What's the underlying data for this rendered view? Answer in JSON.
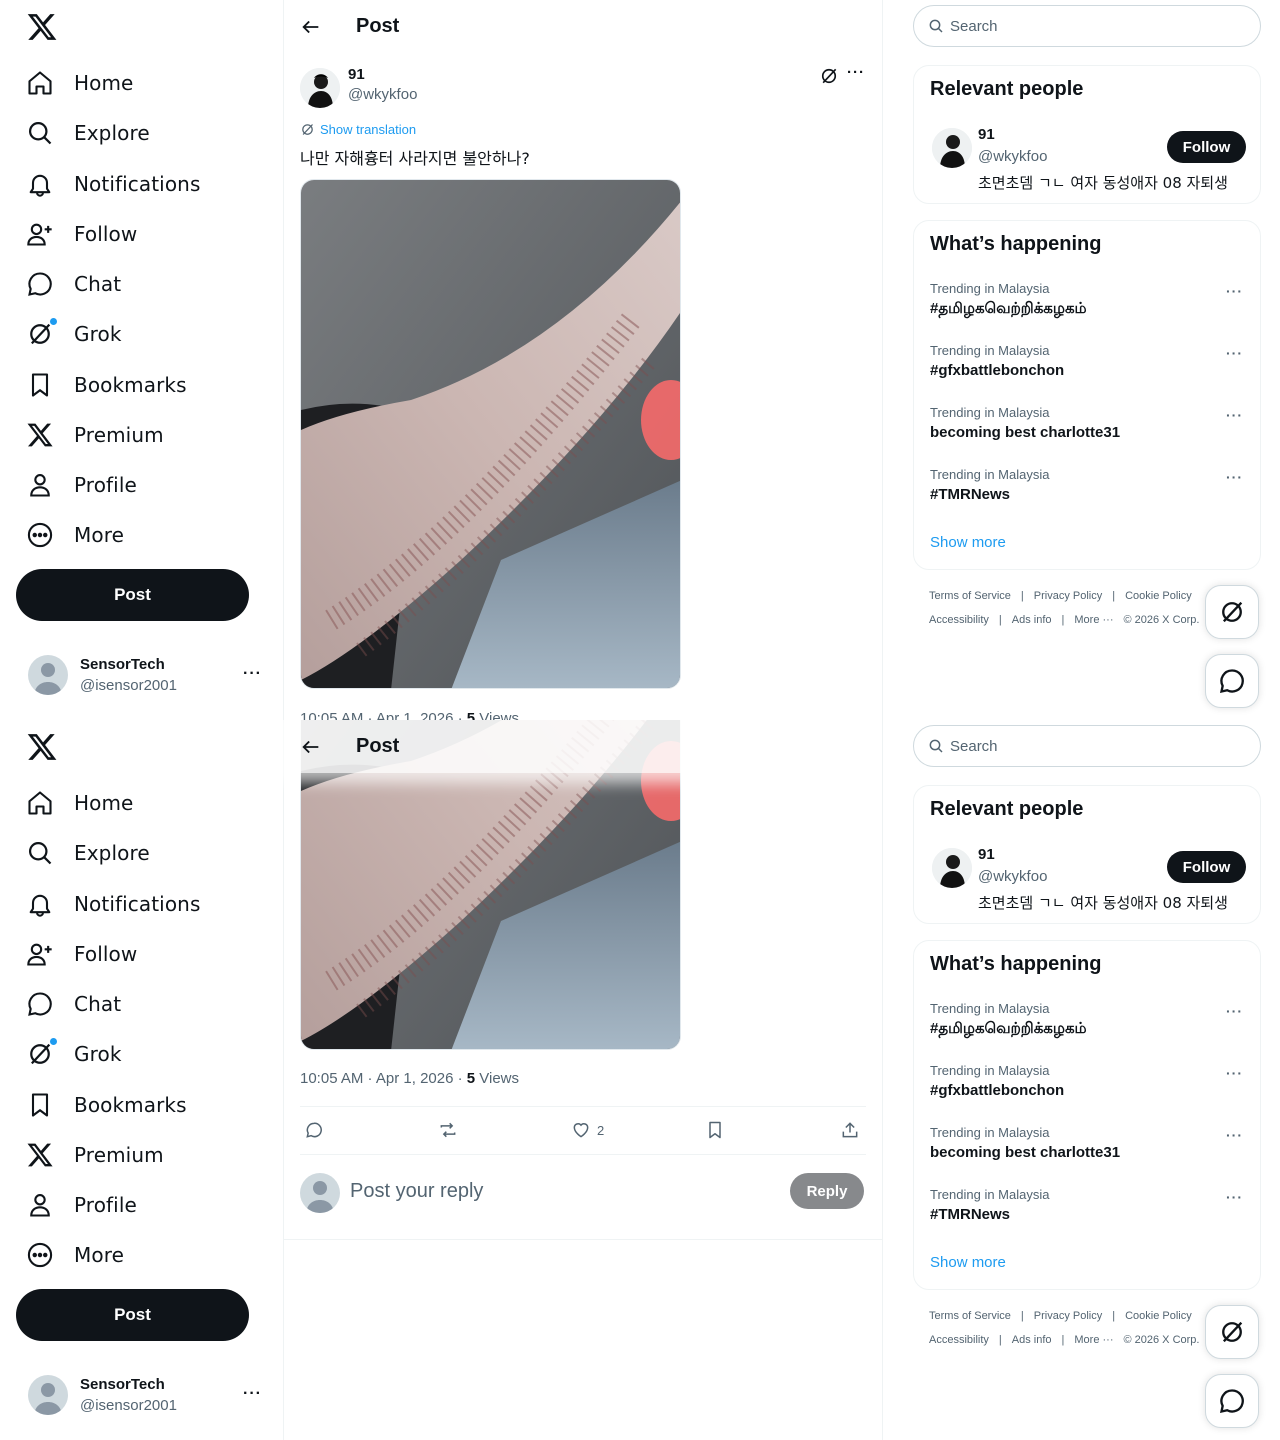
{
  "nav": {
    "items": [
      {
        "label": "Home",
        "icon": "home-icon"
      },
      {
        "label": "Explore",
        "icon": "search-icon"
      },
      {
        "label": "Notifications",
        "icon": "bell-icon"
      },
      {
        "label": "Follow",
        "icon": "person-add-icon"
      },
      {
        "label": "Chat",
        "icon": "chat-bubble-icon"
      },
      {
        "label": "Grok",
        "icon": "grok-icon"
      },
      {
        "label": "Bookmarks",
        "icon": "bookmark-icon"
      },
      {
        "label": "Premium",
        "icon": "x-logo-icon"
      },
      {
        "label": "Profile",
        "icon": "person-icon"
      },
      {
        "label": "More",
        "icon": "more-circle-icon"
      }
    ],
    "post_label": "Post"
  },
  "account": {
    "name": "SensorTech",
    "handle": "@isensor2001"
  },
  "header": {
    "title": "Post"
  },
  "post": {
    "author_name": "91",
    "author_handle": "@wkykfoo",
    "show_translation": "Show translation",
    "text": "나만 자해흉터 사라지면 불안하나?",
    "meta_time": "10:05 AM · Apr 1, 2026 · ",
    "views_count": "5",
    "views_label": " Views",
    "likes": "2"
  },
  "reply": {
    "placeholder": "Post your reply",
    "button": "Reply"
  },
  "search": {
    "placeholder": "Search"
  },
  "relevant": {
    "title": "Relevant people",
    "name": "91",
    "handle": "@wkykfoo",
    "bio": "초면초뎀 ㄱㄴ 여자 동성애자 08 자퇴생",
    "follow": "Follow"
  },
  "happening": {
    "title": "What’s happening",
    "trends": [
      {
        "meta": "Trending in Malaysia",
        "name": "#தமிழகவெற்றிக்கழகம்"
      },
      {
        "meta": "Trending in Malaysia",
        "name": "#gfxbattlebonchon"
      },
      {
        "meta": "Trending in Malaysia",
        "name": "becoming best charlotte31"
      },
      {
        "meta": "Trending in Malaysia",
        "name": "#TMRNews"
      }
    ],
    "show_more": "Show more"
  },
  "footer": {
    "line1": [
      "Terms of Service",
      "|",
      "Privacy Policy",
      "|",
      "Cookie Policy"
    ],
    "line2": [
      "Accessibility",
      "|",
      "Ads info",
      "|",
      "More ···",
      "© 2026 X Corp."
    ]
  }
}
